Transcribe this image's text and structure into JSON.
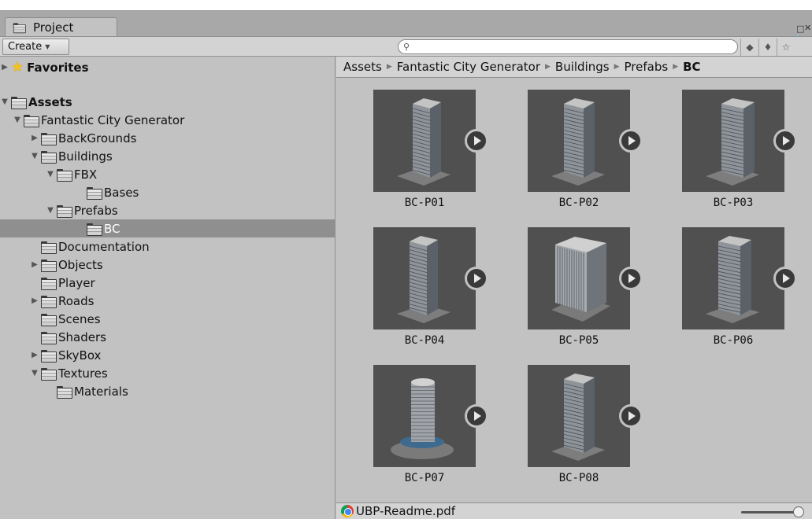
{
  "window": {
    "tab_label": "Project"
  },
  "toolbar": {
    "create_label": "Create",
    "search_placeholder": ""
  },
  "tree": {
    "favorites": "Favorites",
    "assets": "Assets",
    "items": [
      {
        "label": "Fantastic City Generator",
        "depth": 1,
        "expanded": true
      },
      {
        "label": "BackGrounds",
        "depth": 2,
        "expanded": false
      },
      {
        "label": "Buildings",
        "depth": 2,
        "expanded": true
      },
      {
        "label": "FBX",
        "depth": 3,
        "expanded": true
      },
      {
        "label": "Bases",
        "depth": 4,
        "expanded": null
      },
      {
        "label": "Prefabs",
        "depth": 3,
        "expanded": true
      },
      {
        "label": "BC",
        "depth": 4,
        "expanded": null,
        "selected": true
      },
      {
        "label": "Documentation",
        "depth": 2,
        "expanded": null
      },
      {
        "label": "Objects",
        "depth": 2,
        "expanded": false
      },
      {
        "label": "Player",
        "depth": 2,
        "expanded": null
      },
      {
        "label": "Roads",
        "depth": 2,
        "expanded": false
      },
      {
        "label": "Scenes",
        "depth": 2,
        "expanded": null
      },
      {
        "label": "Shaders",
        "depth": 2,
        "expanded": null
      },
      {
        "label": "SkyBox",
        "depth": 2,
        "expanded": false
      },
      {
        "label": "Textures",
        "depth": 2,
        "expanded": true
      },
      {
        "label": "Materials",
        "depth": 3,
        "expanded": null
      }
    ]
  },
  "breadcrumb": [
    "Assets",
    "Fantastic City Generator",
    "Buildings",
    "Prefabs",
    "BC"
  ],
  "assets": [
    {
      "name": "BC-P01",
      "style": "tower"
    },
    {
      "name": "BC-P02",
      "style": "tower"
    },
    {
      "name": "BC-P03",
      "style": "tower"
    },
    {
      "name": "BC-P04",
      "style": "tower"
    },
    {
      "name": "BC-P05",
      "style": "block"
    },
    {
      "name": "BC-P06",
      "style": "tower"
    },
    {
      "name": "BC-P07",
      "style": "round"
    },
    {
      "name": "BC-P08",
      "style": "tower"
    }
  ],
  "status": {
    "selected_file": "UBP-Readme.pdf"
  },
  "colors": {
    "selection": "#8f8f8f",
    "panel": "#c2c2c2",
    "thumb_bg": "#505050"
  }
}
